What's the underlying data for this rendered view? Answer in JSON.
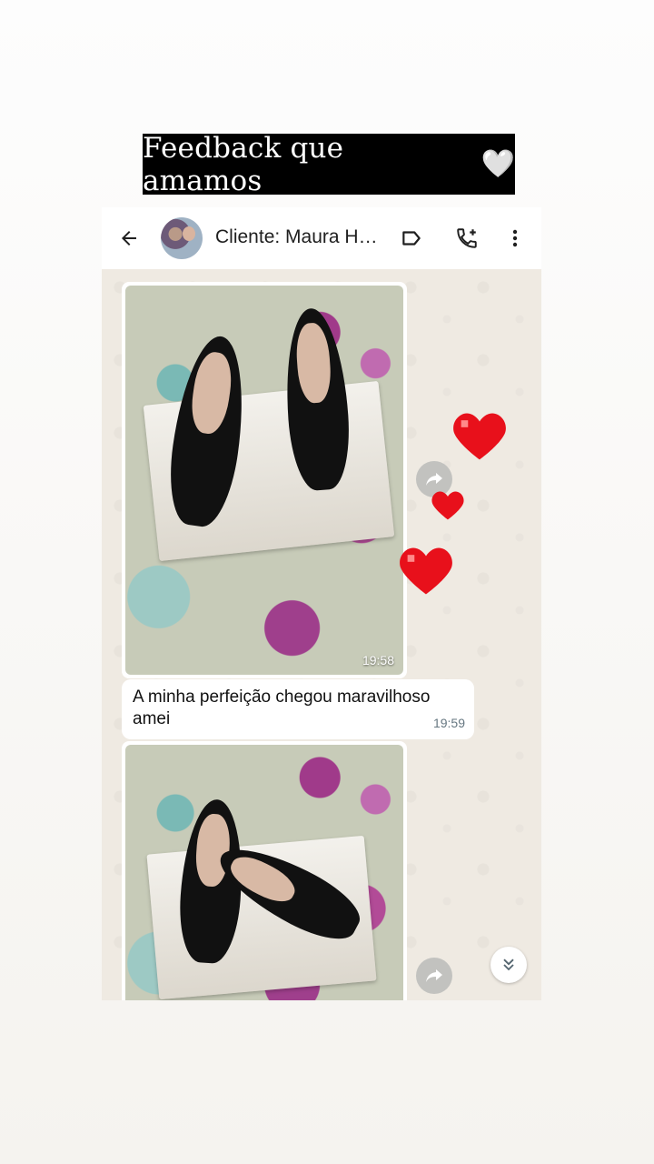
{
  "banner": {
    "title": "Feedback que amamos",
    "heart_emoji": "🤍"
  },
  "chat_header": {
    "back_icon": "arrow-left-icon",
    "contact_name": "Cliente: Maura Herrera",
    "label_icon": "label-icon",
    "call_icon": "add-call-icon",
    "menu_icon": "more-vert-icon"
  },
  "messages": [
    {
      "type": "image",
      "description_icon": "shoes-photo",
      "time": "19:58"
    },
    {
      "type": "text",
      "text": "A minha perfeição chegou maravilhoso amei",
      "time": "19:59"
    },
    {
      "type": "image",
      "description_icon": "shoes-photo",
      "time": ""
    }
  ],
  "decorations": {
    "hearts": [
      "red-heart",
      "red-heart",
      "red-heart"
    ],
    "heart_color": "#e8101b"
  },
  "colors": {
    "chat_bg": "#efeae2",
    "bubble": "#ffffff",
    "timestamp": "#667781",
    "banner_bg": "#000000"
  }
}
